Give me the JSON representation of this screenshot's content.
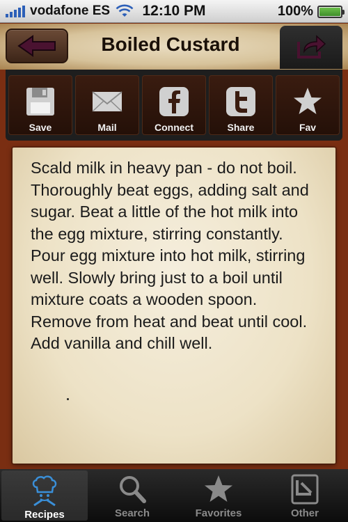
{
  "status_bar": {
    "carrier": "vodafone ES",
    "time": "12:10 PM",
    "battery": "100%",
    "battery_level": 1.0
  },
  "header": {
    "title": "Boiled Custard",
    "back_icon": "arrow-left-icon",
    "share_icon": "share-arrow-icon"
  },
  "actions": {
    "save": "Save",
    "mail": "Mail",
    "connect": "Connect",
    "share": "Share",
    "fav": "Fav"
  },
  "recipe": {
    "instructions": "Scald milk in heavy pan - do not boil. Thoroughly beat eggs, adding salt and sugar. Beat a little of the hot milk into the egg mixture, stirring constantly. Pour egg mixture into hot milk, stirring well. Slowly bring just to a boil until mixture coats a wooden spoon. Remove from heat and beat until cool. Add vanilla and chill well."
  },
  "tabs": {
    "recipes": "Recipes",
    "search": "Search",
    "favorites": "Favorites",
    "other": "Other",
    "active": "recipes"
  },
  "colors": {
    "accent_blue": "#3a8fd8",
    "leather_brown": "#3a1c10",
    "parchment": "#ede2c6"
  }
}
